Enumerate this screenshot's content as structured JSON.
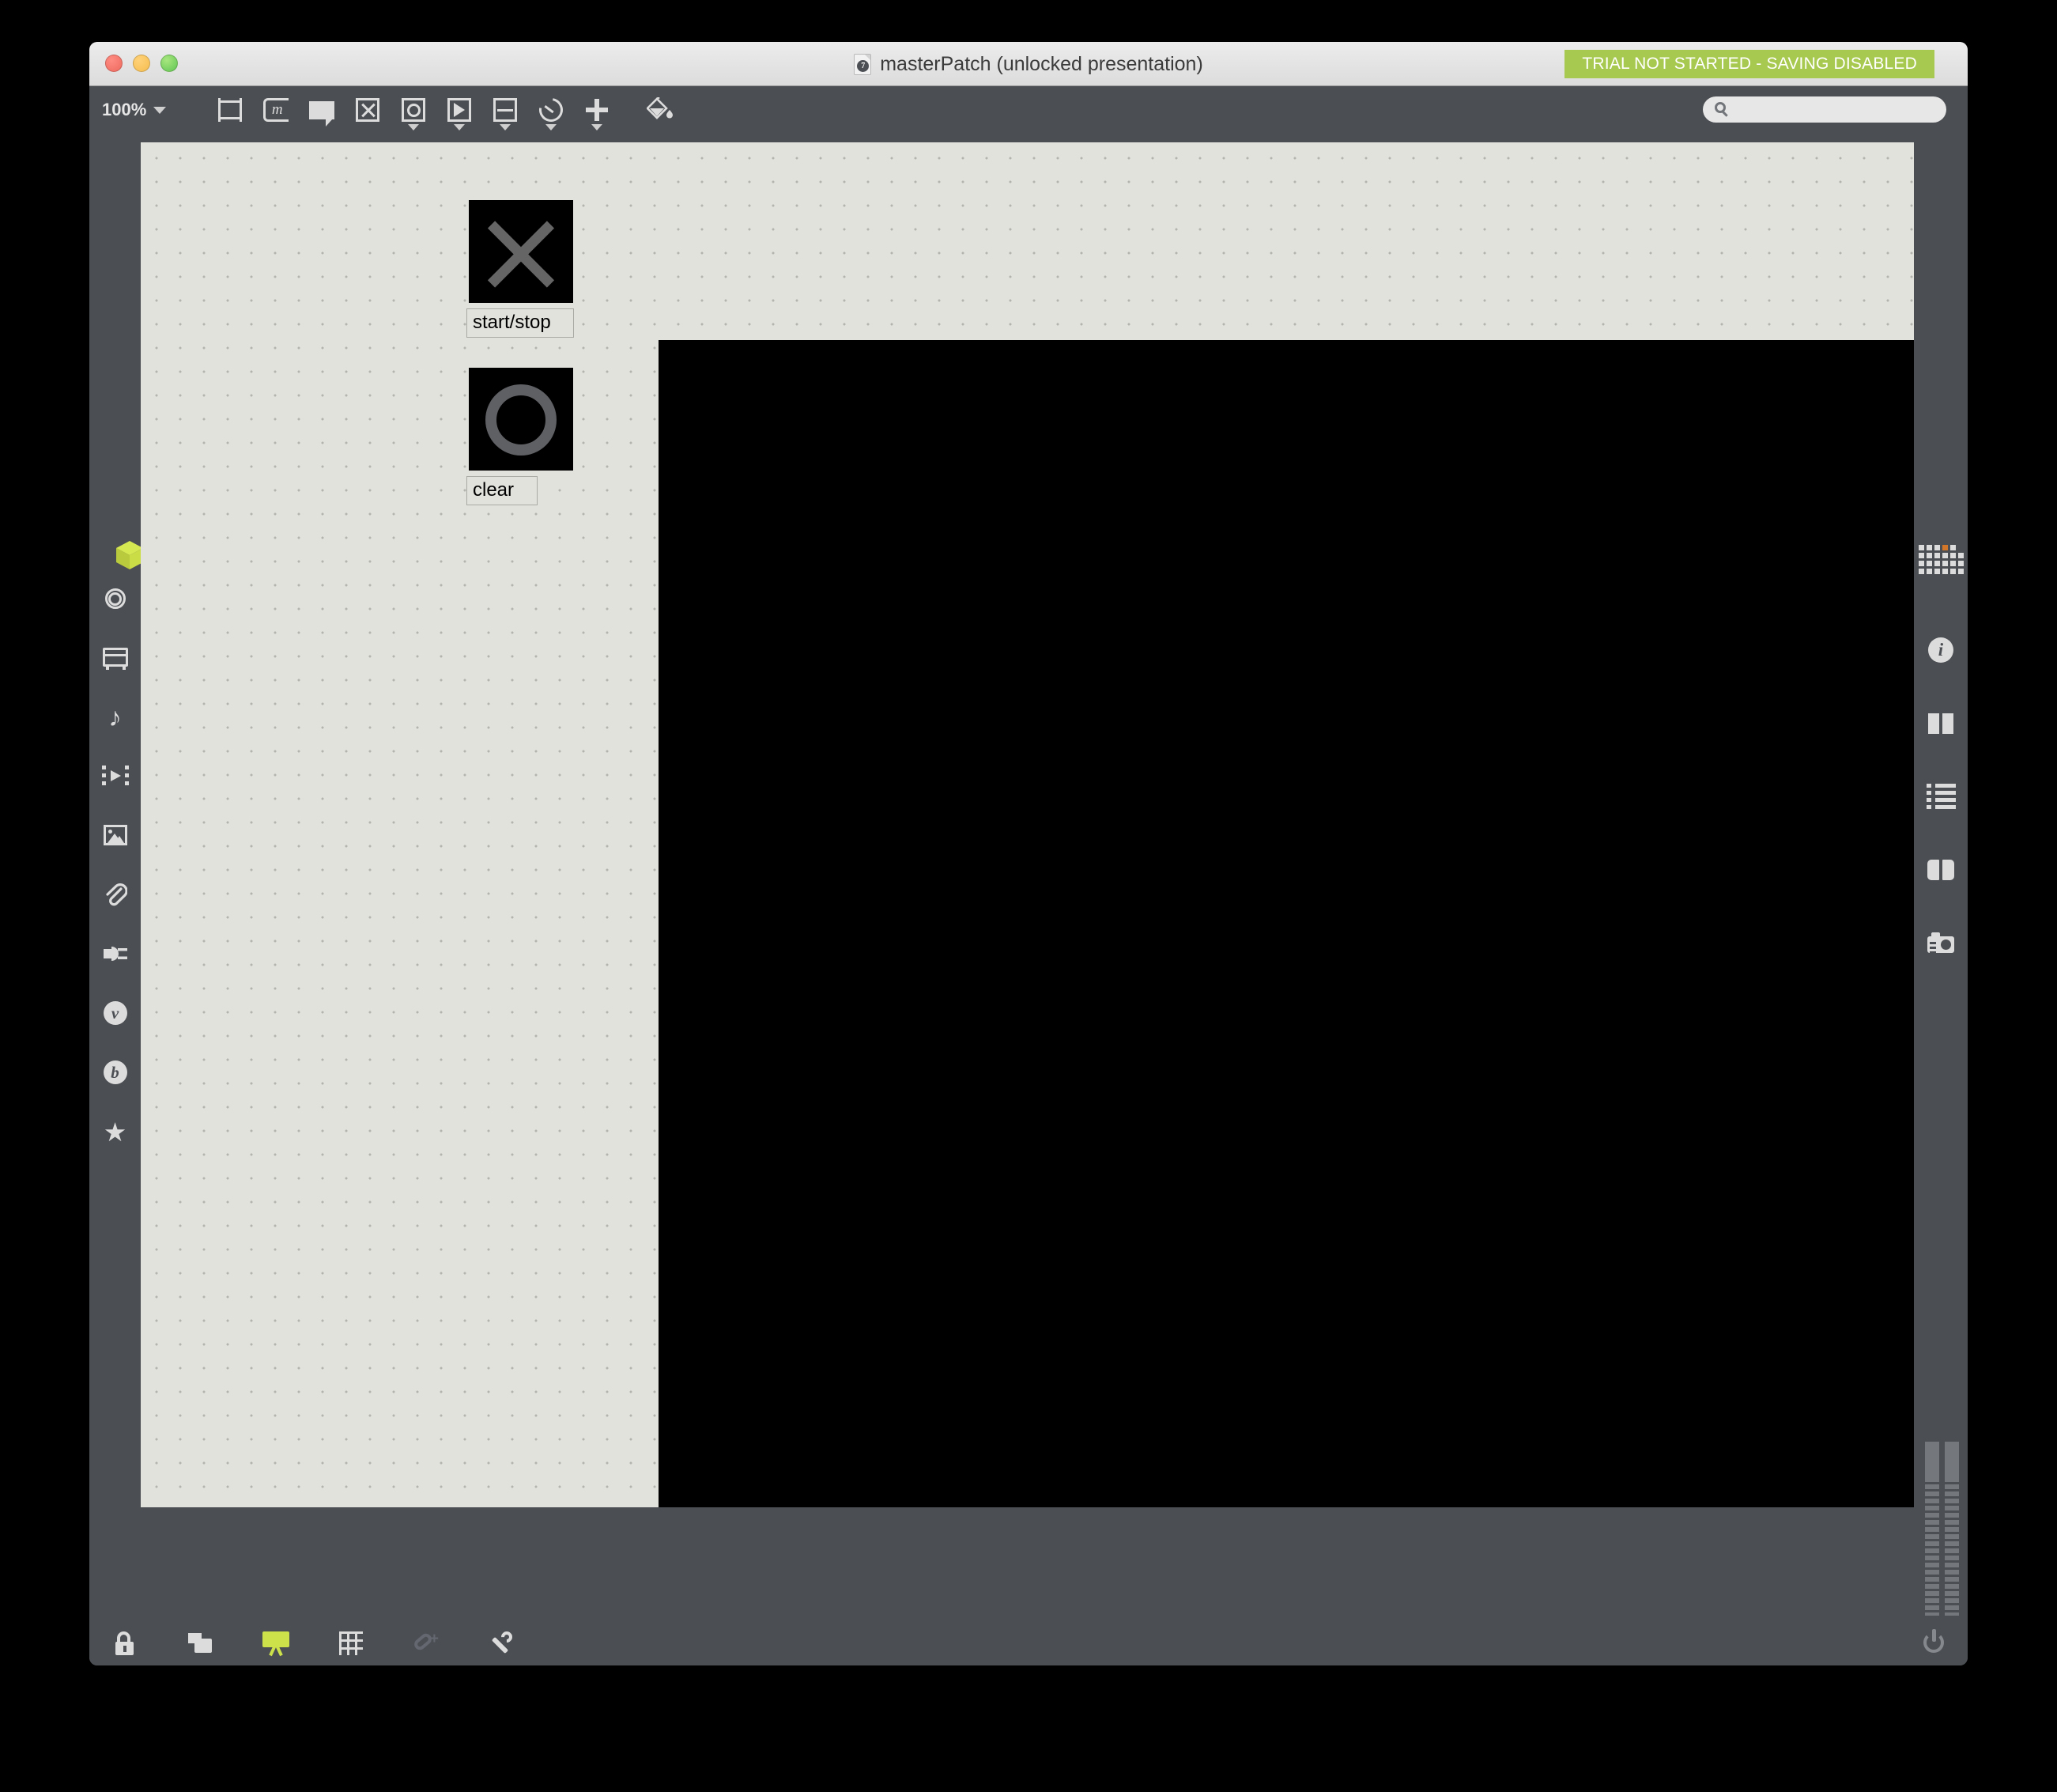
{
  "window": {
    "title": "masterPatch (unlocked presentation)",
    "doc_icon_badge": "7",
    "traffic_lights": [
      "close",
      "minimize",
      "zoom"
    ],
    "trial_banner": "TRIAL NOT STARTED - SAVING DISABLED",
    "trial_banner_color": "#a8c94f"
  },
  "toolbar": {
    "zoom_level": "100%",
    "tools": [
      {
        "name": "object-box-tool",
        "label": "Object"
      },
      {
        "name": "message-box-tool",
        "label": "m"
      },
      {
        "name": "comment-tool",
        "label": "Comment"
      },
      {
        "name": "toggle-tool",
        "label": "Toggle"
      },
      {
        "name": "button-tool",
        "label": "Button"
      },
      {
        "name": "ui-playback-tool",
        "label": "UI"
      },
      {
        "name": "slider-tool",
        "label": "Slider"
      },
      {
        "name": "dial-tool",
        "label": "Dial"
      },
      {
        "name": "more-objects-tool",
        "label": "More"
      },
      {
        "name": "paint-bucket-tool",
        "label": "Paint"
      }
    ],
    "search": {
      "placeholder": "",
      "value": "",
      "icon": "search-icon"
    }
  },
  "left_sidebar": {
    "items": [
      {
        "icon": "cube-icon",
        "label": "Packages",
        "active": true,
        "color": "#cde14b"
      },
      {
        "icon": "target-icon",
        "label": "Snapshots",
        "active": false
      },
      {
        "icon": "rack-icon",
        "label": "Devices",
        "active": false
      },
      {
        "icon": "music-note-icon",
        "label": "Audio",
        "active": false
      },
      {
        "icon": "film-play-icon",
        "label": "Video",
        "active": false
      },
      {
        "icon": "image-icon",
        "label": "Images",
        "active": false
      },
      {
        "icon": "paperclip-icon",
        "label": "Attachments",
        "active": false
      },
      {
        "icon": "plug-icon",
        "label": "Connections",
        "active": false
      },
      {
        "icon": "vizzie-icon",
        "label": "v",
        "active": false
      },
      {
        "icon": "beap-icon",
        "label": "b",
        "active": false
      },
      {
        "icon": "star-icon",
        "label": "Favorites",
        "active": false
      }
    ]
  },
  "right_sidebar": {
    "items": [
      {
        "icon": "dot-grid-icon",
        "label": "Object Explorer",
        "accent": "#d2762a"
      },
      {
        "icon": "info-icon",
        "label": "Inspector"
      },
      {
        "icon": "panes-icon",
        "label": "Panes"
      },
      {
        "icon": "list-icon",
        "label": "Parameters"
      },
      {
        "icon": "book-icon",
        "label": "Reference"
      },
      {
        "icon": "camera-icon",
        "label": "Snapshot"
      }
    ],
    "meters": {
      "count": 2,
      "label": "audio-level-meters"
    }
  },
  "canvas": {
    "background_color": "#e1e2dc",
    "grid_dot_color": "#b3b4ae",
    "objects": [
      {
        "name": "toggle-object",
        "type": "toggle",
        "glyph": "x",
        "state": "on"
      },
      {
        "name": "bang-object",
        "type": "bang",
        "glyph": "circle",
        "state": "off"
      }
    ],
    "comments": [
      {
        "name": "comment-start-stop",
        "text": "start/stop"
      },
      {
        "name": "comment-clear",
        "text": "clear"
      }
    ],
    "video_window": {
      "name": "jit-pwindow",
      "background_color": "#000000"
    }
  },
  "bottom_bar": {
    "items": [
      {
        "icon": "unlock-icon",
        "label": "Edit Lock",
        "active": false
      },
      {
        "icon": "layers-icon",
        "label": "Patching/Presentation",
        "active": false
      },
      {
        "icon": "presentation-icon",
        "label": "Presentation Mode",
        "active": true,
        "color": "#cde14b"
      },
      {
        "icon": "grid-icon",
        "label": "Snap to Grid",
        "active": false
      },
      {
        "icon": "add-attachment-icon",
        "label": "Add Attachment",
        "active": false,
        "disabled": true
      },
      {
        "icon": "wrench-icon",
        "label": "Patcher Inspector",
        "active": false
      }
    ],
    "power": {
      "icon": "power-icon",
      "label": "Audio On/Off"
    }
  }
}
